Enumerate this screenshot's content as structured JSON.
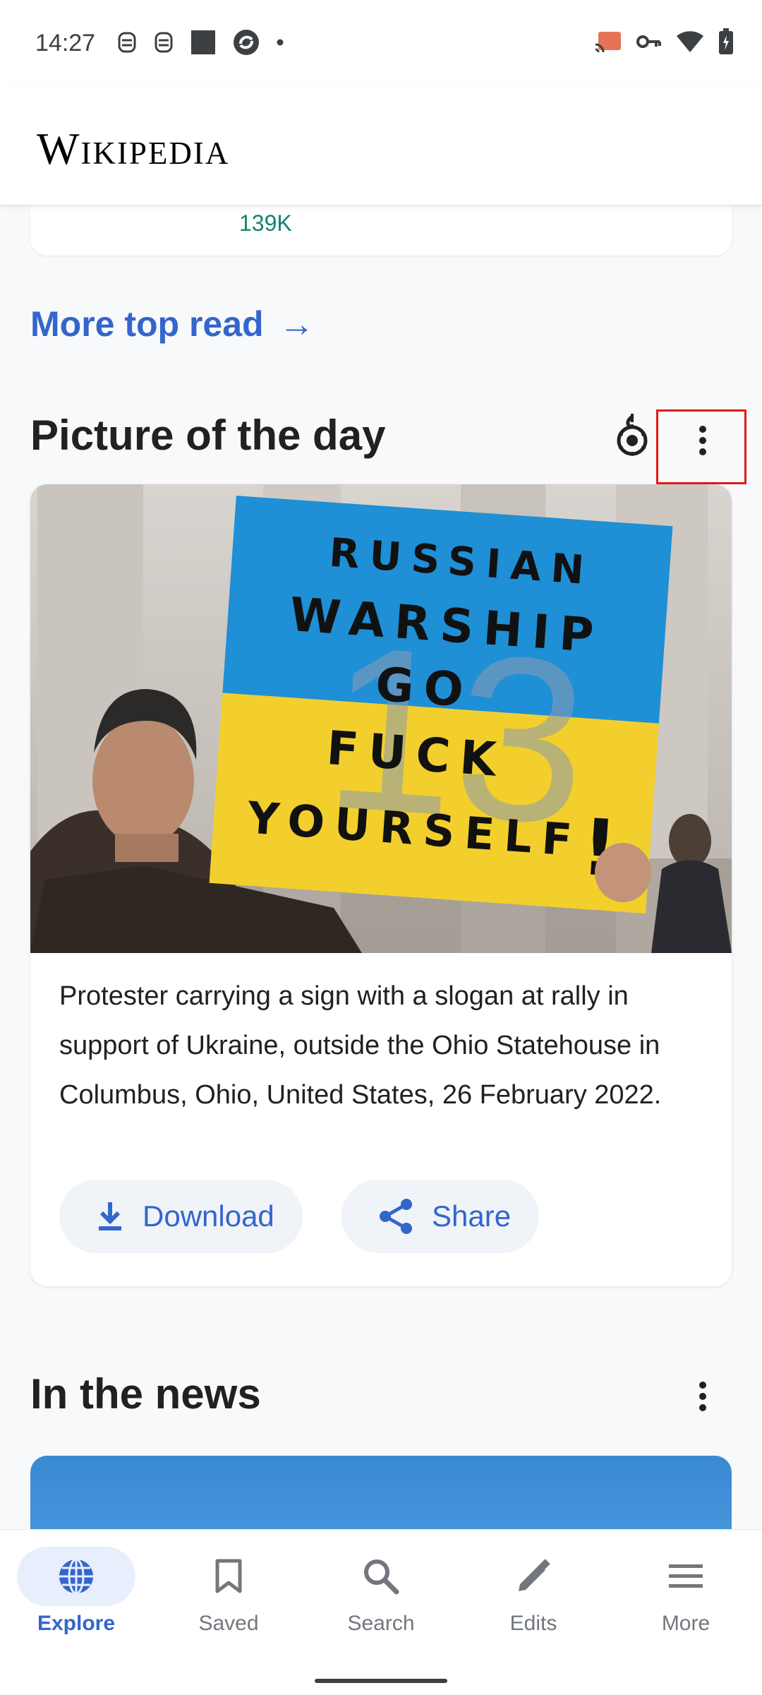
{
  "status_bar": {
    "time": "14:27"
  },
  "app_bar": {
    "logo_text": "Wikipedia"
  },
  "top_read": {
    "pageviews": "139K",
    "more_link": "More top read",
    "arrow": "→"
  },
  "potd": {
    "title": "Picture of the day",
    "sign_lines": [
      "RUSSIAN",
      "WARSHIP",
      "GO",
      "FUCK",
      "YOURSELF",
      "!"
    ],
    "sign_overlay": "13",
    "caption": "Protester carrying a sign with a slogan at rally in support of Ukraine, outside the Ohio Statehouse in Columbus, Ohio, United States, 26 February 2022.",
    "download_label": "Download",
    "share_label": "Share"
  },
  "news": {
    "title": "In the news"
  },
  "bottom_nav": {
    "items": [
      {
        "label": "Explore",
        "icon": "globe-icon",
        "active": true
      },
      {
        "label": "Saved",
        "icon": "bookmark-icon",
        "active": false
      },
      {
        "label": "Search",
        "icon": "search-icon",
        "active": false
      },
      {
        "label": "Edits",
        "icon": "pencil-icon",
        "active": false
      },
      {
        "label": "More",
        "icon": "menu-icon",
        "active": false
      }
    ]
  },
  "colors": {
    "accent": "#3366cc",
    "pageviews": "#14866d",
    "highlight": "#e01b1b"
  }
}
